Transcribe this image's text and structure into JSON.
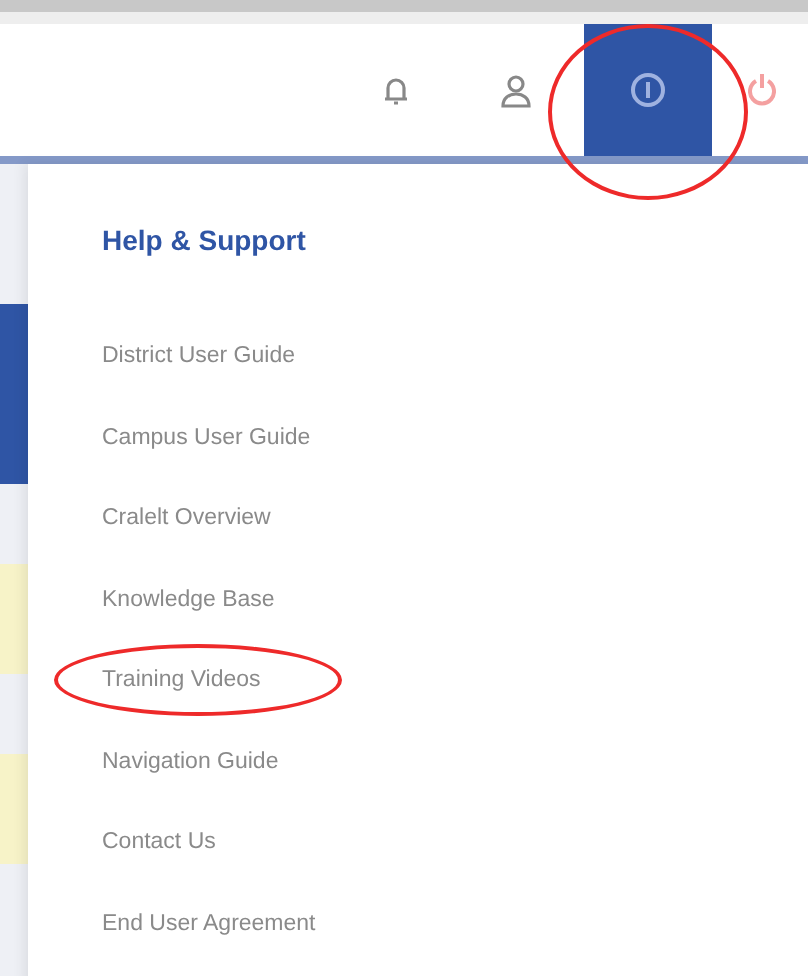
{
  "toolbar": {
    "buttons": [
      {
        "kind": "bell",
        "selected": false,
        "circled": false
      },
      {
        "kind": "person",
        "selected": false,
        "circled": false
      },
      {
        "kind": "help",
        "selected": true,
        "circled": true
      },
      {
        "kind": "power",
        "selected": false,
        "circled": false
      }
    ]
  },
  "menu": {
    "title": "Help & Support",
    "items": [
      {
        "label": "District User Guide",
        "circled": false
      },
      {
        "label": "Campus User Guide",
        "circled": false
      },
      {
        "label": "Cralelt Overview",
        "circled": false
      },
      {
        "label": "Knowledge Base",
        "circled": false
      },
      {
        "label": "Training Videos",
        "circled": true
      },
      {
        "label": "Navigation Guide",
        "circled": false
      },
      {
        "label": "Contact Us",
        "circled": false
      },
      {
        "label": "End User Agreement",
        "circled": false
      }
    ]
  }
}
